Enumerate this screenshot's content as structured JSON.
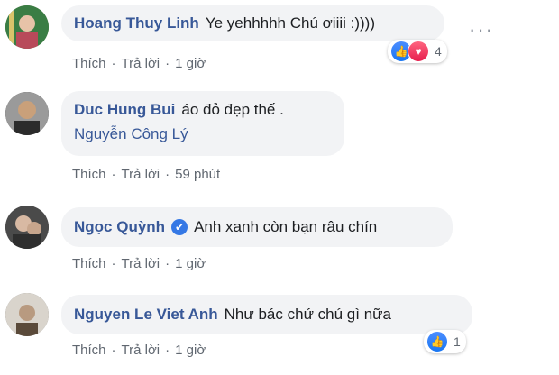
{
  "comments": [
    {
      "name": "Hoang Thuy Linh",
      "text": "Ye yehhhhh Chú ơiiii :))))",
      "actions": {
        "like": "Thích",
        "reply": "Trả lời",
        "time": "1 giờ"
      },
      "reactions": {
        "count": "4",
        "types": [
          "like",
          "love"
        ]
      },
      "more_label": "···",
      "avatar_colors": [
        "#3a7d44",
        "#b84a5a"
      ]
    },
    {
      "name": "Duc Hung Bui",
      "text": "áo đỏ đẹp thế .",
      "tag": "Nguyễn Công Lý",
      "actions": {
        "like": "Thích",
        "reply": "Trả lời",
        "time": "59 phút"
      },
      "avatar_colors": [
        "#2b2b2b",
        "#c9a07a"
      ]
    },
    {
      "name": "Ngọc Quỳnh",
      "verified": true,
      "text": "Anh xanh còn bạn râu chín",
      "actions": {
        "like": "Thích",
        "reply": "Trả lời",
        "time": "1 giờ"
      },
      "avatar_colors": [
        "#3b3b3b",
        "#d8b9a3"
      ]
    },
    {
      "name": "Nguyen Le Viet Anh",
      "text": "Như bác chứ chú gì nữa",
      "actions": {
        "like": "Thích",
        "reply": "Trả lời",
        "time": "1 giờ"
      },
      "reactions": {
        "count": "1",
        "types": [
          "like"
        ]
      },
      "avatar_colors": [
        "#d9d4cc",
        "#5a4a3a"
      ]
    }
  ]
}
